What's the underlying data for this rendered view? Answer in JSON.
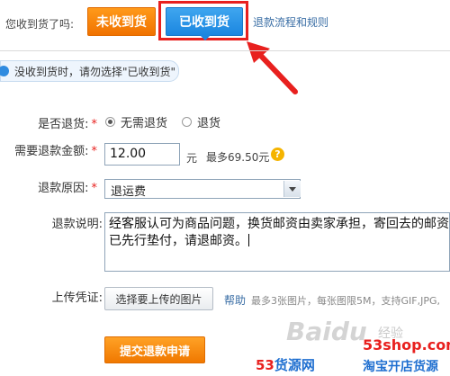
{
  "header": {
    "question": "您收到货了吗:",
    "not_received_label": "未收到货",
    "received_label": "已收到货",
    "rules_link": "退款流程和规则"
  },
  "notice": {
    "text": "没收到货时，请勿选择\"已收到货\""
  },
  "form": {
    "return_goods": {
      "label": "是否退货:",
      "required_mark": "*",
      "options": [
        {
          "label": "无需退货",
          "selected": true
        },
        {
          "label": "退货",
          "selected": false
        }
      ]
    },
    "refund_amount": {
      "label": "需要退款金额:",
      "required_mark": "*",
      "value": "12.00",
      "unit": "元",
      "max_text": "最多69.50元"
    },
    "refund_reason": {
      "label": "退款原因:",
      "required_mark": "*",
      "selected": "退运费"
    },
    "refund_description": {
      "label": "退款说明:",
      "line1": "经客服认可为商品问题，换货邮资由卖家承担，寄回去的邮资",
      "line2": "已先行垫付，请退邮资。"
    },
    "upload": {
      "label": "上传凭证:",
      "button_label": "选择要上传的图片",
      "help_link": "帮助",
      "hint": "最多3张图片，每张图限5M，支持GIF,JPG,"
    },
    "submit_label": "提交退款申请"
  },
  "watermarks": {
    "baidu": "Baidu",
    "jingyan": "经验",
    "domain": "53shop.com",
    "brand_red": "53",
    "brand_mid": "货源网",
    "slogan": "淘宝开店货源"
  },
  "colors": {
    "orange_button": "#f07200",
    "blue_button": "#1b86e0",
    "highlight_red": "#e8201e",
    "link_blue": "#3a6ea5"
  },
  "icons": {
    "info": "info-circle-icon",
    "help": "question-mark-icon",
    "select_arrow": "chevron-down-icon",
    "annotation": "red-arrow-icon"
  }
}
